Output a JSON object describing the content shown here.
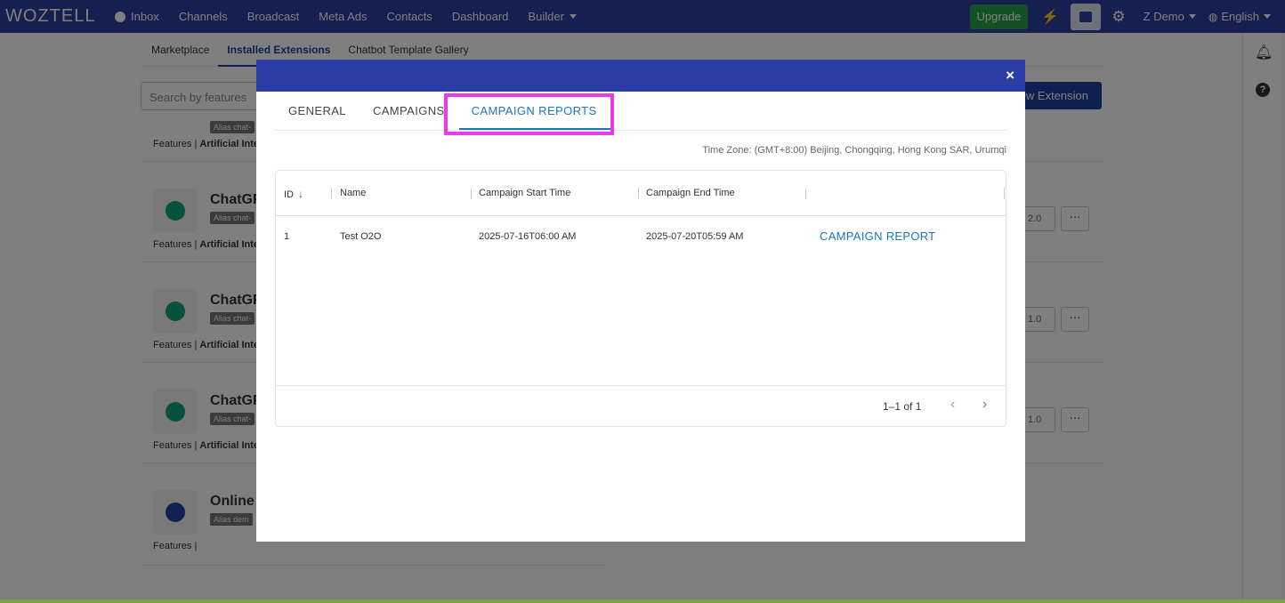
{
  "navbar": {
    "logo": "WOZTELL",
    "items": [
      {
        "label": "Inbox"
      },
      {
        "label": "Channels"
      },
      {
        "label": "Broadcast"
      },
      {
        "label": "Meta Ads"
      },
      {
        "label": "Contacts"
      },
      {
        "label": "Dashboard"
      },
      {
        "label": "Builder"
      }
    ],
    "upgrade_label": "Upgrade",
    "user_label": "Z Demo",
    "language_label": "English"
  },
  "background": {
    "subtabs": [
      {
        "label": "Marketplace"
      },
      {
        "label": "Installed Extensions"
      },
      {
        "label": "Chatbot Template Gallery"
      }
    ],
    "search_placeholder": "Search by features",
    "new_extension_label": "ew Extension",
    "extensions": [
      {
        "name": "ChatGP",
        "alias": "Alias",
        "alias_value": "chat-",
        "features_prefix": "Features | ",
        "features": "Artificial Intel",
        "version": "2.0"
      },
      {
        "name": "ChatGP",
        "alias": "Alias",
        "alias_value": "chat-",
        "features_prefix": "Features | ",
        "features": "Artificial Intel",
        "version": "1.0"
      },
      {
        "name": "ChatGP",
        "alias": "Alias",
        "alias_value": "chat-",
        "features_prefix": "Features | ",
        "features": "Artificial Intel",
        "version": "1.0"
      },
      {
        "name": "Online",
        "alias": "Alias",
        "alias_value": "dem",
        "features_prefix": "Features | ",
        "features": "",
        "version": ""
      }
    ],
    "partial_top": {
      "alias": "Alias",
      "alias_value": "chat-",
      "features_prefix": "Features | ",
      "features": "Artificial Intel"
    }
  },
  "modal": {
    "close_label": "×",
    "tabs": [
      {
        "label": "GENERAL"
      },
      {
        "label": "CAMPAIGNS"
      },
      {
        "label": "CAMPAIGN REPORTS"
      }
    ],
    "timezone": "Time Zone: (GMT+8:00) Beijing, Chongqing, Hong Kong SAR, Urumqi",
    "columns": {
      "id": "ID",
      "name": "Name",
      "start": "Campaign Start Time",
      "end": "Campaign End Time"
    },
    "rows": [
      {
        "id": "1",
        "name": "Test O2O",
        "start": "2025-07-16T06:00 AM",
        "end": "2025-07-20T05:59 AM",
        "action": "CAMPAIGN REPORT"
      }
    ],
    "pagination": "1–1 of 1"
  },
  "colors": {
    "navbar": "#2c3e9e",
    "modal_header": "#2c3ea6",
    "accent": "#1b75bc",
    "highlight": "#ec39e6",
    "upgrade": "#27a348"
  }
}
